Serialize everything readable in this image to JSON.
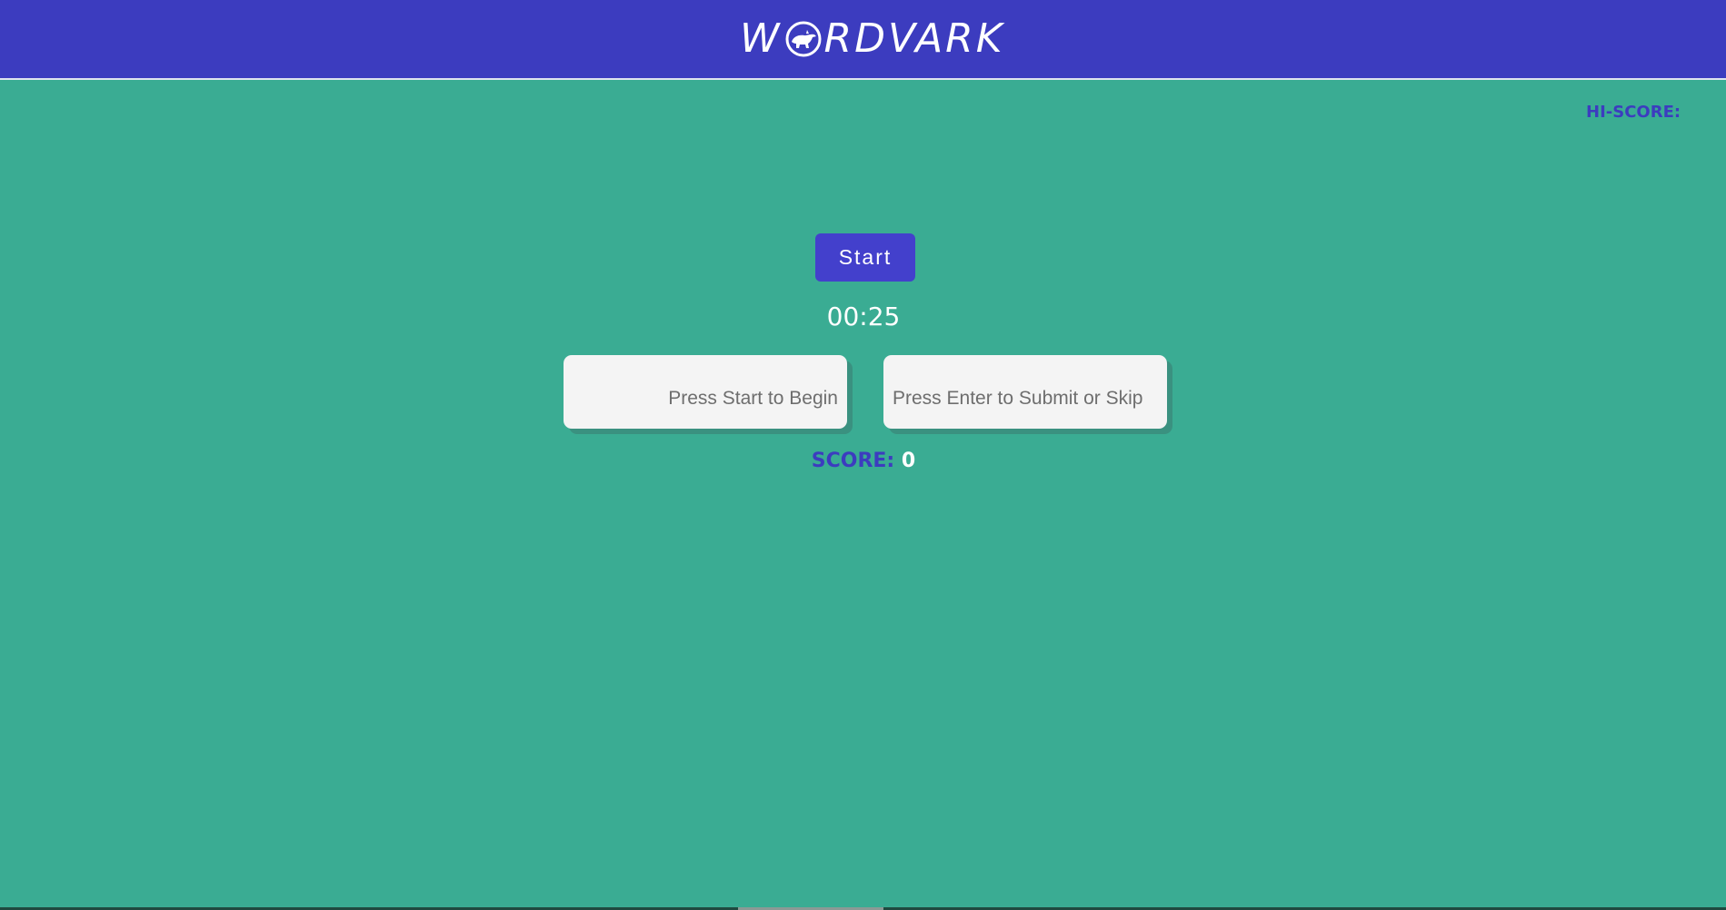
{
  "header": {
    "logo_left": "W",
    "logo_right": "RDVARK",
    "logo_emblem": "aardvark-emblem-icon"
  },
  "hiscore": {
    "label": "HI-SCORE:"
  },
  "controls": {
    "start_label": "Start",
    "timer": "00:25",
    "word_field_placeholder": "Press Start to Begin",
    "answer_field_placeholder": "Press Enter to Submit or Skip"
  },
  "score": {
    "label": "SCORE:",
    "value": "0"
  },
  "colors": {
    "header": "#3c3cbf",
    "background": "#3aac93",
    "button": "#4340cc",
    "accent_text": "#3c3cbf"
  }
}
